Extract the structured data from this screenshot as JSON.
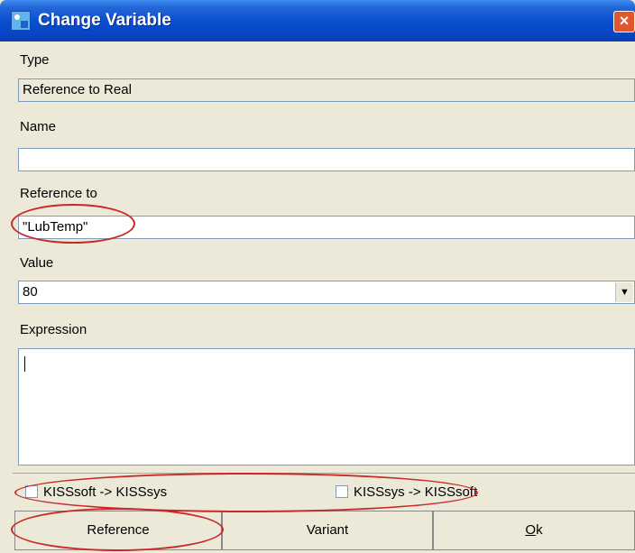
{
  "window": {
    "title": "Change Variable",
    "close_symbol": "×"
  },
  "type": {
    "label": "Type",
    "value": "Reference to Real"
  },
  "name": {
    "label": "Name",
    "value": ""
  },
  "reference_to": {
    "label": "Reference to",
    "value": "\"LubTemp\""
  },
  "value": {
    "label": "Value",
    "selected": "80",
    "arrow": "▼"
  },
  "expression": {
    "label": "Expression",
    "value": ""
  },
  "checkboxes": [
    {
      "label": "KISSsoft -> KISSsys",
      "checked": false
    },
    {
      "label": "KISSsys -> KISSsoft",
      "checked": false
    }
  ],
  "buttons": {
    "reference": "Reference",
    "variant": "Variant",
    "ok_mnemonic": "O",
    "ok_rest": "k"
  },
  "annotation_color": "#c82828"
}
